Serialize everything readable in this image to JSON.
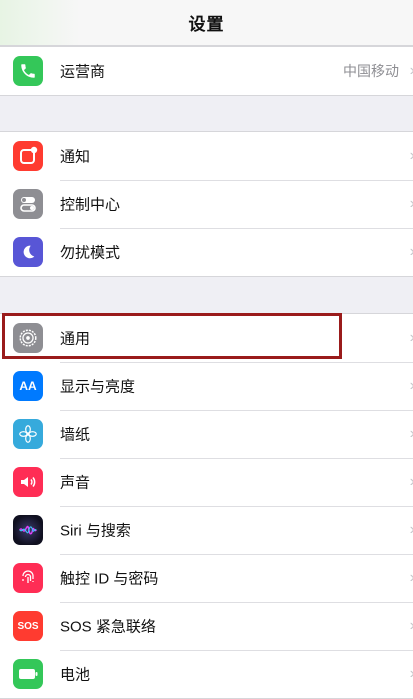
{
  "header": {
    "title": "设置"
  },
  "groups": [
    {
      "items": [
        {
          "label": "运营商",
          "detail": "中国移动",
          "icon": "phone-icon",
          "color": "#34c759"
        }
      ]
    },
    {
      "items": [
        {
          "label": "通知",
          "icon": "notifications-icon",
          "color": "#ff3b30"
        },
        {
          "label": "控制中心",
          "icon": "control-center-icon",
          "color": "#8e8e93"
        },
        {
          "label": "勿扰模式",
          "icon": "moon-icon",
          "color": "#5856d6"
        }
      ]
    },
    {
      "items": [
        {
          "label": "通用",
          "icon": "gear-icon",
          "color": "#8e8e93"
        },
        {
          "label": "显示与亮度",
          "icon": "display-brightness-icon",
          "color": "#007aff",
          "icon_text": "AA"
        },
        {
          "label": "墙纸",
          "icon": "wallpaper-flower-icon",
          "color": "#36aadc"
        },
        {
          "label": "声音",
          "icon": "speaker-icon",
          "color": "#ff2d55"
        },
        {
          "label": "Siri 与搜索",
          "icon": "siri-icon",
          "color": "#1c1c3a"
        },
        {
          "label": "触控 ID 与密码",
          "icon": "fingerprint-icon",
          "color": "#ff2d55"
        },
        {
          "label": "SOS 紧急联络",
          "icon": "sos-icon",
          "color": "#ff3b30",
          "icon_text": "SOS"
        },
        {
          "label": "电池",
          "icon": "battery-icon",
          "color": "#34c759"
        }
      ]
    }
  ]
}
